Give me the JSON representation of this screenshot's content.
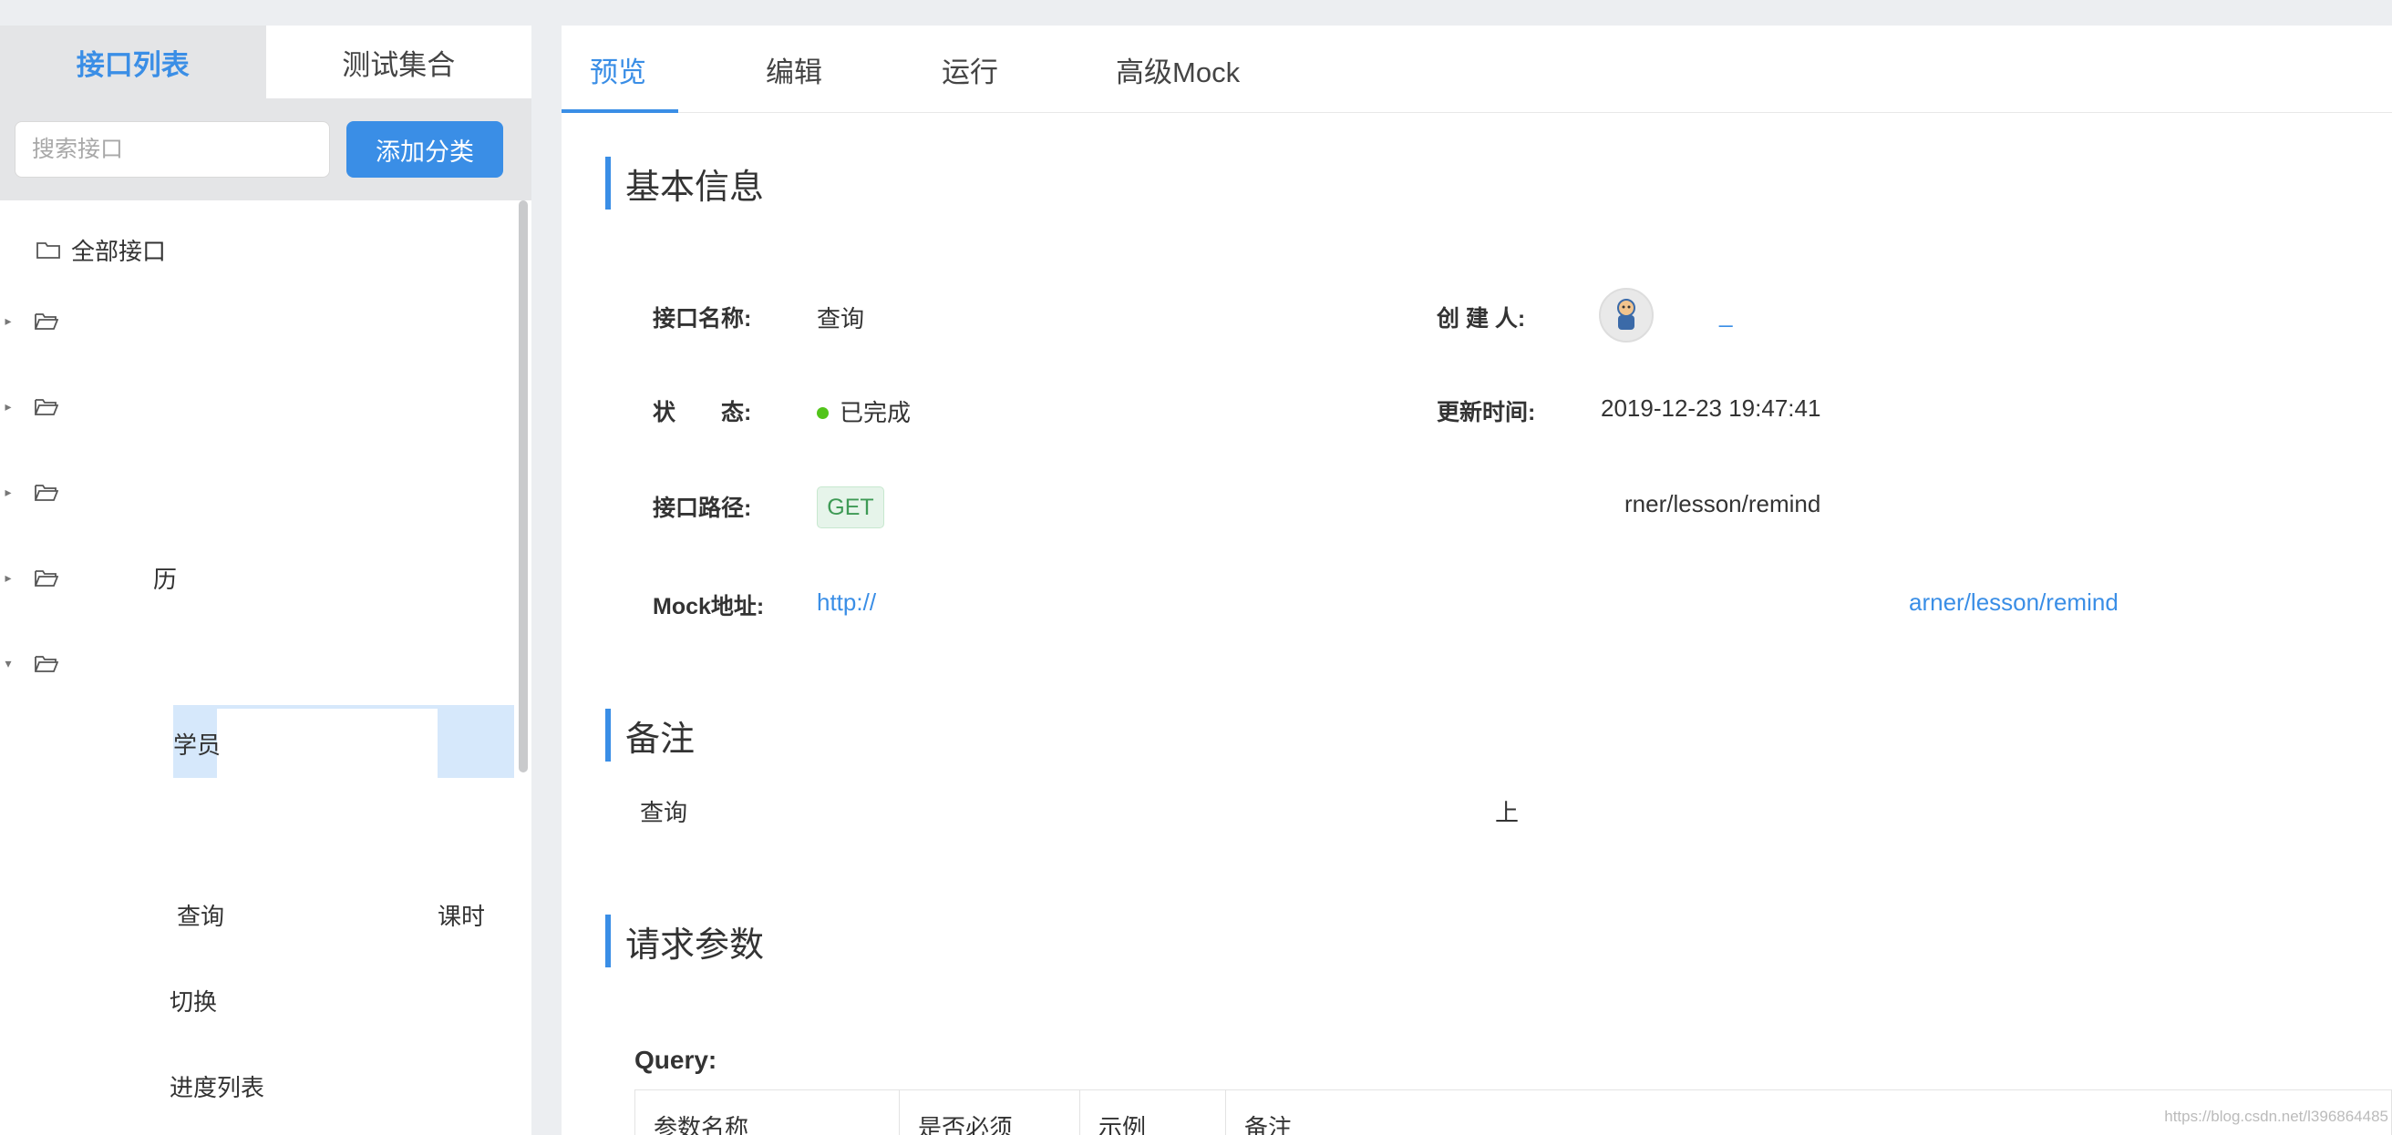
{
  "sidebar": {
    "tabs": [
      "接口列表",
      "测试集合"
    ],
    "search_placeholder": "搜索接口",
    "add_category_label": "添加分类",
    "all_interfaces_label": "全部接口",
    "categories": [
      {
        "label": "",
        "expanded": false
      },
      {
        "label": "",
        "expanded": false
      },
      {
        "label": "",
        "expanded": false
      },
      {
        "label": "历",
        "expanded": false
      },
      {
        "label": "",
        "expanded": true
      }
    ],
    "leaves": [
      "学员",
      "查询",
      "课时",
      "切换",
      "进度列表"
    ]
  },
  "main": {
    "tabs": [
      "预览",
      "编辑",
      "运行",
      "高级Mock"
    ],
    "sections": {
      "basic_info": "基本信息",
      "remark": "备注",
      "request_params": "请求参数"
    },
    "basic": {
      "name_label": "接口名称:",
      "name_value": "查询",
      "creator_label": "创 建 人:",
      "creator_value": "_",
      "status_label": "状　　态:",
      "status_value": "已完成",
      "updated_label": "更新时间:",
      "updated_value": "2019-12-23 19:47:41",
      "path_label": "接口路径:",
      "method": "GET",
      "path_value": "rner/lesson/remind",
      "mock_label": "Mock地址:",
      "mock_prefix": "http://",
      "mock_suffix": "arner/lesson/remind"
    },
    "remark": {
      "text_left": "查询",
      "text_right": "上"
    },
    "query_label": "Query:",
    "param_headers": [
      "参数名称",
      "是否必须",
      "示例",
      "备注"
    ]
  },
  "watermark": "https://blog.csdn.net/l396864485",
  "colors": {
    "accent": "#3a8ee6",
    "status_done": "#52c41a",
    "method_get_bg": "#e6f4ea",
    "method_get_text": "#3e9a55"
  }
}
